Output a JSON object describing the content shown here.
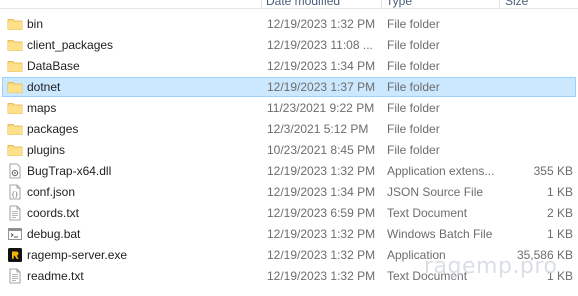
{
  "header": {
    "columns": [
      {
        "label": "Date modified"
      },
      {
        "label": "Type"
      },
      {
        "label": "Size"
      }
    ]
  },
  "files": [
    {
      "name": "bin",
      "date": "12/19/2023 1:32 PM",
      "type": "File folder",
      "size": "",
      "icon": "folder-icon"
    },
    {
      "name": "client_packages",
      "date": "12/19/2023 11:08 ...",
      "type": "File folder",
      "size": "",
      "icon": "folder-icon"
    },
    {
      "name": "DataBase",
      "date": "12/19/2023 1:34 PM",
      "type": "File folder",
      "size": "",
      "icon": "folder-icon"
    },
    {
      "name": "dotnet",
      "date": "12/19/2023 1:37 PM",
      "type": "File folder",
      "size": "",
      "icon": "folder-icon",
      "selected": true
    },
    {
      "name": "maps",
      "date": "11/23/2021 9:22 PM",
      "type": "File folder",
      "size": "",
      "icon": "folder-icon"
    },
    {
      "name": "packages",
      "date": "12/3/2021 5:12 PM",
      "type": "File folder",
      "size": "",
      "icon": "folder-icon"
    },
    {
      "name": "plugins",
      "date": "10/23/2021 8:45 PM",
      "type": "File folder",
      "size": "",
      "icon": "folder-icon"
    },
    {
      "name": "BugTrap-x64.dll",
      "date": "12/19/2023 1:32 PM",
      "type": "Application extens...",
      "size": "355 KB",
      "icon": "dll-file-icon"
    },
    {
      "name": "conf.json",
      "date": "12/19/2023 1:34 PM",
      "type": "JSON Source File",
      "size": "1 KB",
      "icon": "json-file-icon"
    },
    {
      "name": "coords.txt",
      "date": "12/19/2023 6:59 PM",
      "type": "Text Document",
      "size": "2 KB",
      "icon": "text-file-icon"
    },
    {
      "name": "debug.bat",
      "date": "12/19/2023 1:32 PM",
      "type": "Windows Batch File",
      "size": "1 KB",
      "icon": "batch-file-icon"
    },
    {
      "name": "ragemp-server.exe",
      "date": "12/19/2023 1:32 PM",
      "type": "Application",
      "size": "35,586 KB",
      "icon": "ragemp-app-icon"
    },
    {
      "name": "readme.txt",
      "date": "12/19/2023 1:32 PM",
      "type": "Text Document",
      "size": "1 KB",
      "icon": "text-file-icon"
    }
  ],
  "watermark": "ragemp.pro",
  "colors": {
    "selection_bg": "#cce8ff",
    "selection_border": "#99d1ff",
    "folder": "#f8d775",
    "secondary_text": "#6d6d6d"
  }
}
